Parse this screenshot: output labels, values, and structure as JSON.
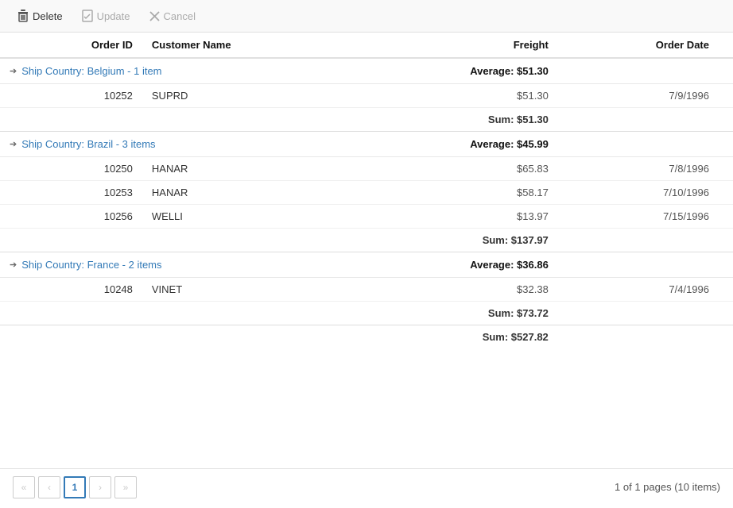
{
  "toolbar": {
    "delete_label": "Delete",
    "update_label": "Update",
    "cancel_label": "Cancel"
  },
  "grid": {
    "columns": {
      "order_id": "Order ID",
      "customer_name": "Customer Name",
      "freight": "Freight",
      "order_date": "Order Date"
    },
    "groups": [
      {
        "id": "belgium",
        "title": "Ship Country: Belgium - 1 item",
        "average": "Average: $51.30",
        "sum": "Sum: $51.30",
        "expanded": true,
        "rows": [
          {
            "order_id": "10252",
            "customer": "SUPRD",
            "freight": "$51.30",
            "order_date": "7/9/1996"
          }
        ]
      },
      {
        "id": "brazil",
        "title": "Ship Country: Brazil - 3 items",
        "average": "Average: $45.99",
        "sum": "Sum: $137.97",
        "expanded": true,
        "rows": [
          {
            "order_id": "10250",
            "customer": "HANAR",
            "freight": "$65.83",
            "order_date": "7/8/1996"
          },
          {
            "order_id": "10253",
            "customer": "HANAR",
            "freight": "$58.17",
            "order_date": "7/10/1996"
          },
          {
            "order_id": "10256",
            "customer": "WELLI",
            "freight": "$13.97",
            "order_date": "7/15/1996"
          }
        ]
      },
      {
        "id": "france",
        "title": "Ship Country: France - 2 items",
        "average": "Average: $36.86",
        "sum": "Sum: $73.72",
        "expanded": true,
        "rows": [
          {
            "order_id": "10248",
            "customer": "VINET",
            "freight": "$32.38",
            "order_date": "7/4/1996"
          }
        ]
      }
    ],
    "total_sum": "Sum: $527.82"
  },
  "pager": {
    "first_label": "«",
    "prev_label": "‹",
    "current_page": "1",
    "next_label": "›",
    "last_label": "»",
    "info": "1 of 1 pages (10 items)"
  }
}
